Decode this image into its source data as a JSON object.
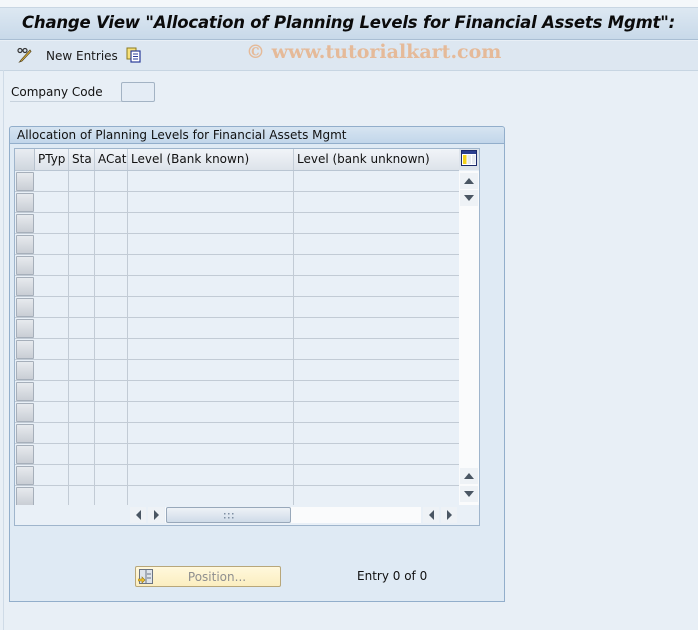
{
  "window": {
    "title": "Change View \"Allocation of Planning Levels for Financial Assets Mgmt\":"
  },
  "toolbar": {
    "items": [
      {
        "icon": "change-display-icon",
        "label": ""
      },
      {
        "icon": "",
        "label": "New Entries"
      },
      {
        "icon": "copy-as-icon",
        "label": ""
      }
    ],
    "new_entries_label": "New Entries"
  },
  "watermark": "© www.tutorialkart.com",
  "filter": {
    "company_code_label": "Company Code",
    "company_code_value": ""
  },
  "group": {
    "title": "Allocation of Planning Levels for Financial Assets Mgmt",
    "table": {
      "columns": [
        {
          "key": "ptyp",
          "label": "PTyp"
        },
        {
          "key": "sta",
          "label": "Sta"
        },
        {
          "key": "acat",
          "label": "ACat"
        },
        {
          "key": "level_bank_known",
          "label": "Level (Bank known)"
        },
        {
          "key": "level_bank_unknown",
          "label": "Level (bank unknown)"
        }
      ],
      "rows": [
        {
          "ptyp": "",
          "sta": "",
          "acat": "",
          "level_bank_known": "",
          "level_bank_unknown": ""
        },
        {
          "ptyp": "",
          "sta": "",
          "acat": "",
          "level_bank_known": "",
          "level_bank_unknown": ""
        },
        {
          "ptyp": "",
          "sta": "",
          "acat": "",
          "level_bank_known": "",
          "level_bank_unknown": ""
        },
        {
          "ptyp": "",
          "sta": "",
          "acat": "",
          "level_bank_known": "",
          "level_bank_unknown": ""
        },
        {
          "ptyp": "",
          "sta": "",
          "acat": "",
          "level_bank_known": "",
          "level_bank_unknown": ""
        },
        {
          "ptyp": "",
          "sta": "",
          "acat": "",
          "level_bank_known": "",
          "level_bank_unknown": ""
        },
        {
          "ptyp": "",
          "sta": "",
          "acat": "",
          "level_bank_known": "",
          "level_bank_unknown": ""
        },
        {
          "ptyp": "",
          "sta": "",
          "acat": "",
          "level_bank_known": "",
          "level_bank_unknown": ""
        },
        {
          "ptyp": "",
          "sta": "",
          "acat": "",
          "level_bank_known": "",
          "level_bank_unknown": ""
        },
        {
          "ptyp": "",
          "sta": "",
          "acat": "",
          "level_bank_known": "",
          "level_bank_unknown": ""
        },
        {
          "ptyp": "",
          "sta": "",
          "acat": "",
          "level_bank_known": "",
          "level_bank_unknown": ""
        },
        {
          "ptyp": "",
          "sta": "",
          "acat": "",
          "level_bank_known": "",
          "level_bank_unknown": ""
        },
        {
          "ptyp": "",
          "sta": "",
          "acat": "",
          "level_bank_known": "",
          "level_bank_unknown": ""
        },
        {
          "ptyp": "",
          "sta": "",
          "acat": "",
          "level_bank_known": "",
          "level_bank_unknown": ""
        },
        {
          "ptyp": "",
          "sta": "",
          "acat": "",
          "level_bank_known": "",
          "level_bank_unknown": ""
        },
        {
          "ptyp": "",
          "sta": "",
          "acat": "",
          "level_bank_known": "",
          "level_bank_unknown": ""
        }
      ]
    },
    "position_button_label": "Position...",
    "entry_status": "Entry 0 of 0"
  },
  "colors": {
    "background": "#e8eff6",
    "titlebar": "#c8d9e9",
    "group_border": "#92aecb",
    "position_button": "#fbeec0"
  }
}
